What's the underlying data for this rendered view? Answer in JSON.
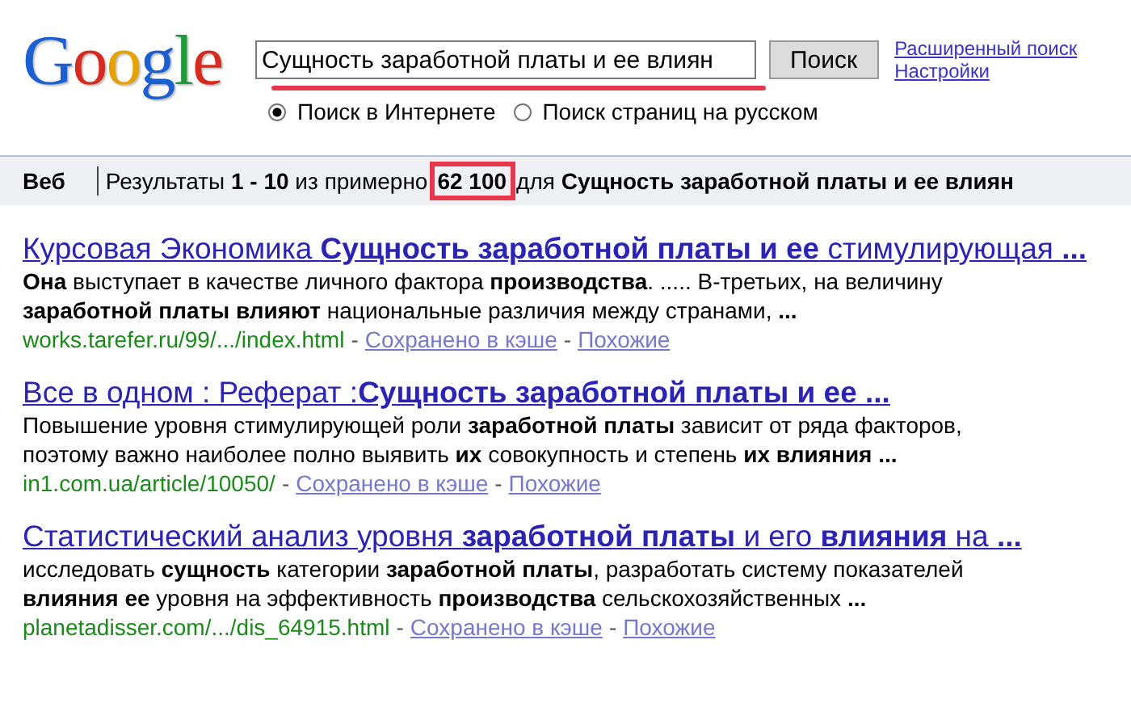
{
  "logo": {
    "text": "Google"
  },
  "search": {
    "value": "Сущность заработной платы и ее влиян",
    "underlined": true
  },
  "search_button": "Поиск",
  "links": [
    "Расширенный поиск",
    "Настройки"
  ],
  "scopes": [
    {
      "label": "Поиск в Интернете",
      "selected": true
    },
    {
      "label": "Поиск страниц на русском",
      "selected": false
    }
  ],
  "stats_bar": {
    "tab": "Веб",
    "prefix": "Результаты **1 - 10** из примерно",
    "count": "62 100",
    "count_boxed": true,
    "suffix": "для **Сущность заработной платы и ее влиян**"
  },
  "results": [
    {
      "title": "Курсовая Экономика **Сущность заработной платы и ее** стимулирующая **...**",
      "snippet": [
        "**Она** выступает в качестве личного фактора **производства**. ..... В-третьих, на величину",
        "**заработной платы влияют** национальные различия между странами, **...**"
      ],
      "url": "works.tarefer.ru/99/.../index.html",
      "separators": [
        "-",
        "-"
      ],
      "cache": "Сохранено в кэше",
      "similar": "Похожие"
    },
    {
      "title": "Все в одном : Реферат :**Сущность заработной платы и ее ...**",
      "snippet": [
        "Повышение уровня стимулирующей роли **заработной платы** зависит от ряда факторов,",
        "поэтому важно наиболее полно выявить **их** совокупность и степень **их влияния ...**"
      ],
      "url": "in1.com.ua/article/10050/",
      "separators": [
        "-",
        "-"
      ],
      "cache": "Сохранено в кэше",
      "similar": "Похожие"
    },
    {
      "title": "Статистический анализ уровня **заработной платы** и его **влияния** на **...**",
      "snippet": [
        "исследовать **сущность** категории **заработной платы**, разработать систему показателей",
        "**влияния ее** уровня на эффективность **производства** сельскохозяйственных **...**"
      ],
      "url": "planetadisser.com/.../dis_64915.html",
      "separators": [
        "-",
        "-"
      ],
      "cache": "Сохранено в кэше",
      "similar": "Похожие"
    }
  ]
}
